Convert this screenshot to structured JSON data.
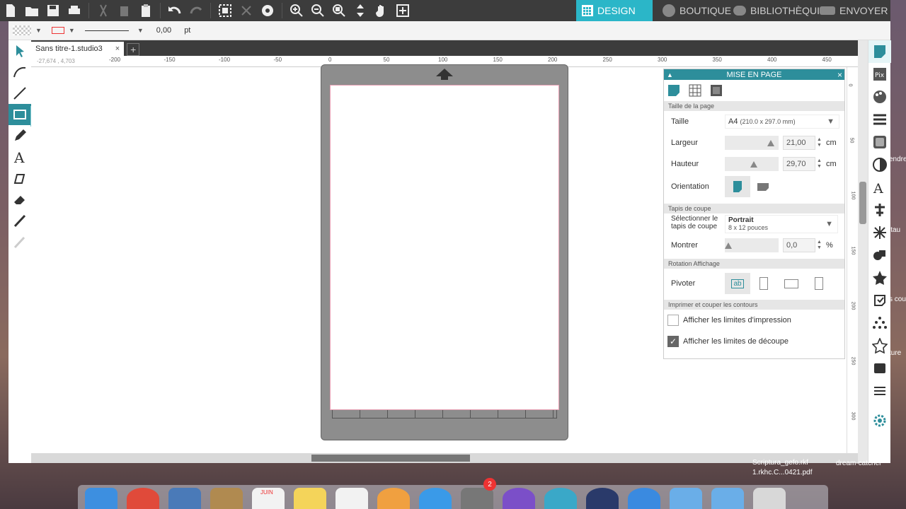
{
  "navtabs": {
    "design": "DESIGN",
    "store": "BOUTIQUE",
    "library": "BIBLIOTHÈQUI",
    "send": "ENVOYER"
  },
  "linebar": {
    "weight": "0,00",
    "unit": "pt"
  },
  "doc": {
    "tab": "Sans titre-1.studio3",
    "close": "×",
    "add": "+"
  },
  "coords": "-27,674 , 4,703",
  "ruler_h": [
    "-200",
    "-150",
    "-100",
    "-50",
    "0",
    "50",
    "100",
    "150",
    "200",
    "250",
    "300",
    "350",
    "400",
    "450"
  ],
  "ruler_v": [
    "0",
    "50",
    "100",
    "150",
    "200",
    "250",
    "300"
  ],
  "panel": {
    "title": "MISE EN PAGE",
    "sec_size": "Taille de la page",
    "size_label": "Taille",
    "size_value": "A4",
    "size_dims": "(210.0 x 297.0 mm)",
    "width_label": "Largeur",
    "width_value": "21,00",
    "width_unit": "cm",
    "height_label": "Hauteur",
    "height_value": "29,70",
    "height_unit": "cm",
    "orient_label": "Orientation",
    "sec_mat": "Tapis de coupe",
    "mat_label": "Sélectionner le tapis de coupe",
    "mat_value": "Portrait",
    "mat_dims": "8 x 12 pouces",
    "show_label": "Montrer",
    "show_value": "0,0",
    "show_unit": "%",
    "sec_rot": "Rotation Affichage",
    "rot_label": "Pivoter",
    "sec_print": "Imprimer et couper les contours",
    "chk1": "Afficher les limites d'impression",
    "chk2": "Afficher les limites de découpe",
    "chk1_on": false,
    "chk2_on": true
  },
  "desktop": {
    "file1": "Scriptura_gefo.rkf",
    "file2": "1.rkhc.C...0421.pdf",
    "file3": "dream-catcher",
    "side1": "endre",
    "side2": "itau",
    "side3": "s cou",
    "side4": "ture"
  },
  "dock": {
    "cal_month": "JUIN",
    "badge": "2"
  },
  "colors": {
    "accent": "#2bb6c8",
    "panel_header": "#2d8e9b"
  }
}
